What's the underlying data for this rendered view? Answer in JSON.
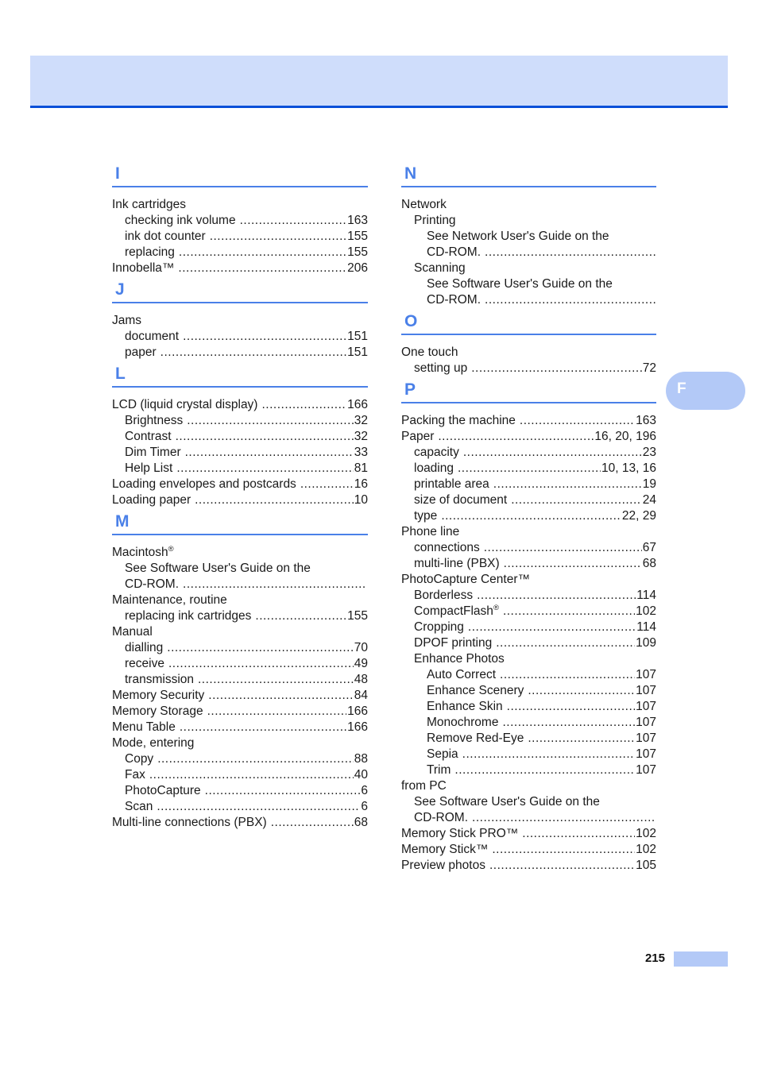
{
  "document": {
    "page_number": "215",
    "side_tab_letter": "F",
    "header_title": ""
  },
  "colors": {
    "heading_blue": "#4a80e8",
    "banner_blue": "#cfddfb",
    "banner_rule": "#0a4fd8",
    "tab_blue": "#b3c9f7",
    "text": "#1a1a1a"
  },
  "leader": "..............................................................................",
  "columns": {
    "left": [
      {
        "letter": "I",
        "entries": [
          {
            "level": 0,
            "label": "Ink cartridges",
            "page": "",
            "leader": false
          },
          {
            "level": 1,
            "label": "checking ink volume",
            "page": "163",
            "leader": true
          },
          {
            "level": 1,
            "label": "ink dot counter",
            "page": "155",
            "leader": true
          },
          {
            "level": 1,
            "label": "replacing",
            "page": "155",
            "leader": true
          },
          {
            "level": 0,
            "label": "Innobella™",
            "page": "206",
            "leader": true
          }
        ]
      },
      {
        "letter": "J",
        "entries": [
          {
            "level": 0,
            "label": "Jams",
            "page": "",
            "leader": false
          },
          {
            "level": 1,
            "label": "document",
            "page": "151",
            "leader": true
          },
          {
            "level": 1,
            "label": "paper",
            "page": "151",
            "leader": true
          }
        ]
      },
      {
        "letter": "L",
        "entries": [
          {
            "level": 0,
            "label": "LCD (liquid crystal display)",
            "page": "166",
            "leader": true
          },
          {
            "level": 1,
            "label": "Brightness",
            "page": "32",
            "leader": true
          },
          {
            "level": 1,
            "label": "Contrast",
            "page": "32",
            "leader": true
          },
          {
            "level": 1,
            "label": "Dim Timer",
            "page": "33",
            "leader": true
          },
          {
            "level": 1,
            "label": "Help List",
            "page": "81",
            "leader": true
          },
          {
            "level": 0,
            "label": "Loading envelopes and postcards",
            "page": "16",
            "leader": true
          },
          {
            "level": 0,
            "label": "Loading paper",
            "page": "10",
            "leader": true
          }
        ]
      },
      {
        "letter": "M",
        "entries": [
          {
            "level": 0,
            "label": "Macintosh®",
            "page": "",
            "leader": false,
            "sup": "®",
            "base": "Macintosh"
          },
          {
            "level": 1,
            "label": "See Software User's Guide on the",
            "page": "",
            "leader": false
          },
          {
            "level": 1,
            "label": "CD-ROM.",
            "page": "",
            "leader": true
          },
          {
            "level": 0,
            "label": "Maintenance, routine",
            "page": "",
            "leader": false
          },
          {
            "level": 1,
            "label": "replacing ink cartridges",
            "page": "155",
            "leader": true
          },
          {
            "level": 0,
            "label": "Manual",
            "page": "",
            "leader": false
          },
          {
            "level": 1,
            "label": "dialling",
            "page": "70",
            "leader": true
          },
          {
            "level": 1,
            "label": "receive",
            "page": "49",
            "leader": true
          },
          {
            "level": 1,
            "label": "transmission",
            "page": "48",
            "leader": true
          },
          {
            "level": 0,
            "label": "Memory Security",
            "page": "84",
            "leader": true
          },
          {
            "level": 0,
            "label": "Memory Storage",
            "page": "166",
            "leader": true
          },
          {
            "level": 0,
            "label": "Menu Table",
            "page": "166",
            "leader": true
          },
          {
            "level": 0,
            "label": "Mode, entering",
            "page": "",
            "leader": false
          },
          {
            "level": 1,
            "label": "Copy",
            "page": "88",
            "leader": true
          },
          {
            "level": 1,
            "label": "Fax",
            "page": "40",
            "leader": true
          },
          {
            "level": 1,
            "label": "PhotoCapture",
            "page": "6",
            "leader": true
          },
          {
            "level": 1,
            "label": "Scan",
            "page": "6",
            "leader": true
          },
          {
            "level": 0,
            "label": "Multi-line connections (PBX)",
            "page": "68",
            "leader": true
          }
        ]
      }
    ],
    "right": [
      {
        "letter": "N",
        "entries": [
          {
            "level": 0,
            "label": "Network",
            "page": "",
            "leader": false
          },
          {
            "level": 1,
            "label": "Printing",
            "page": "",
            "leader": false
          },
          {
            "level": 2,
            "label": "See Network User's Guide on the",
            "page": "",
            "leader": false
          },
          {
            "level": 2,
            "label": "CD-ROM.",
            "page": "",
            "leader": true
          },
          {
            "level": 1,
            "label": "Scanning",
            "page": "",
            "leader": false
          },
          {
            "level": 2,
            "label": "See Software User's Guide on the",
            "page": "",
            "leader": false
          },
          {
            "level": 2,
            "label": "CD-ROM.",
            "page": "",
            "leader": true
          }
        ]
      },
      {
        "letter": "O",
        "entries": [
          {
            "level": 0,
            "label": "One touch",
            "page": "",
            "leader": false
          },
          {
            "level": 1,
            "label": "setting up",
            "page": "72",
            "leader": true
          }
        ]
      },
      {
        "letter": "P",
        "entries": [
          {
            "level": 0,
            "label": "Packing the machine",
            "page": "163",
            "leader": true
          },
          {
            "level": 0,
            "label": "Paper",
            "page": "16, 20, 196",
            "leader": true
          },
          {
            "level": 1,
            "label": "capacity",
            "page": "23",
            "leader": true
          },
          {
            "level": 1,
            "label": "loading",
            "page": "10, 13, 16",
            "leader": true
          },
          {
            "level": 1,
            "label": "printable area",
            "page": "19",
            "leader": true
          },
          {
            "level": 1,
            "label": "size of document",
            "page": "24",
            "leader": true
          },
          {
            "level": 1,
            "label": "type",
            "page": "22, 29",
            "leader": true
          },
          {
            "level": 0,
            "label": "Phone line",
            "page": "",
            "leader": false
          },
          {
            "level": 1,
            "label": "connections",
            "page": "67",
            "leader": true
          },
          {
            "level": 1,
            "label": "multi-line (PBX)",
            "page": "68",
            "leader": true
          },
          {
            "level": 0,
            "label": "PhotoCapture Center™",
            "page": "",
            "leader": false
          },
          {
            "level": 1,
            "label": "Borderless",
            "page": "114",
            "leader": true
          },
          {
            "level": 1,
            "label": "CompactFlash®",
            "page": "102",
            "leader": true,
            "sup": "®",
            "base": "CompactFlash"
          },
          {
            "level": 1,
            "label": "Cropping",
            "page": "114",
            "leader": true
          },
          {
            "level": 1,
            "label": "DPOF printing",
            "page": "109",
            "leader": true
          },
          {
            "level": 1,
            "label": "Enhance Photos",
            "page": "",
            "leader": false
          },
          {
            "level": 2,
            "label": "Auto Correct",
            "page": "107",
            "leader": true
          },
          {
            "level": 2,
            "label": "Enhance Scenery",
            "page": "107",
            "leader": true
          },
          {
            "level": 2,
            "label": "Enhance Skin",
            "page": "107",
            "leader": true
          },
          {
            "level": 2,
            "label": "Monochrome",
            "page": "107",
            "leader": true
          },
          {
            "level": 2,
            "label": "Remove Red-Eye",
            "page": "107",
            "leader": true
          },
          {
            "level": 2,
            "label": "Sepia",
            "page": "107",
            "leader": true
          },
          {
            "level": 2,
            "label": "Trim",
            "page": "107",
            "leader": true
          },
          {
            "level": 0,
            "label": "from PC",
            "page": "",
            "leader": false
          },
          {
            "level": 1,
            "label": "See Software User's Guide on the",
            "page": "",
            "leader": false
          },
          {
            "level": 1,
            "label": "CD-ROM.",
            "page": "",
            "leader": true
          },
          {
            "level": 0,
            "label": "Memory Stick PRO™",
            "page": "102",
            "leader": true
          },
          {
            "level": 0,
            "label": "Memory Stick™",
            "page": "102",
            "leader": true
          },
          {
            "level": 0,
            "label": "Preview photos",
            "page": "105",
            "leader": true
          }
        ]
      }
    ]
  }
}
